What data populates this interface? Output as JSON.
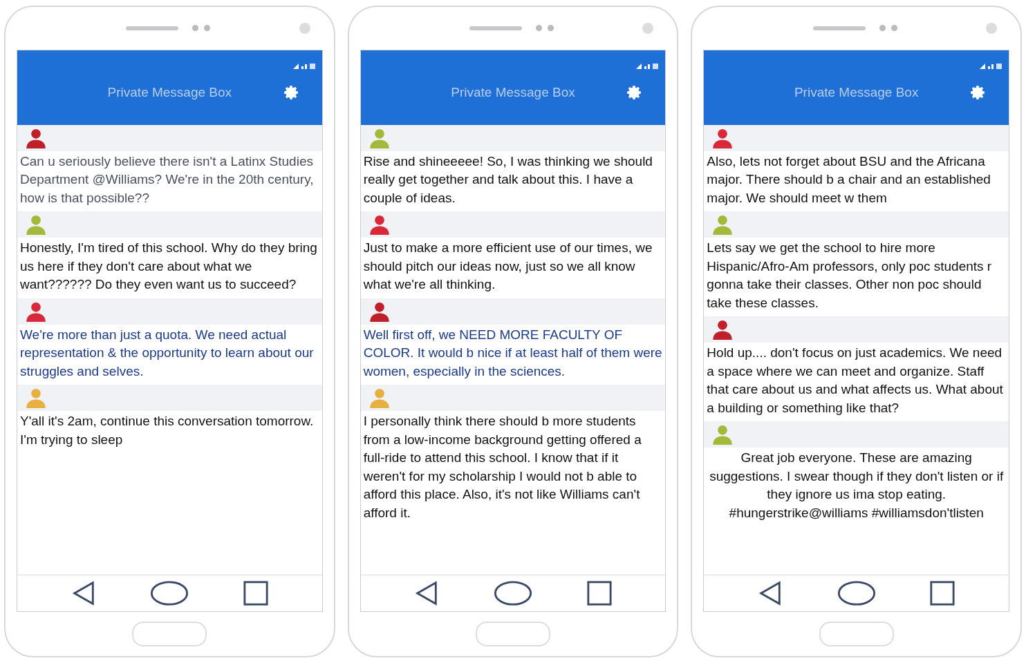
{
  "phones": [
    {
      "title": "Private Message Box",
      "messages": [
        {
          "color": "#c0202a",
          "kind": "muted",
          "text": "Can u seriously believe there isn't a Latinx Studies Department @Williams? We're in the 20th century, how is that possible??"
        },
        {
          "color": "#a4b83a",
          "kind": "plain",
          "text": "Honestly, I'm tired of this school. Why do they bring us here if they don't care about what we want?????? Do they even want us to succeed?"
        },
        {
          "color": "#d8283a",
          "kind": "accent",
          "text": "We're more than just a quota. We need actual representation & the opportunity to learn about our struggles and selves."
        },
        {
          "color": "#e8b040",
          "kind": "plain",
          "text": "Y'all it's 2am, continue this conversation tomorrow. I'm trying to sleep"
        }
      ]
    },
    {
      "title": "Private Message Box",
      "messages": [
        {
          "color": "#a4b83a",
          "kind": "plain",
          "text": "Rise and shineeeee! So, I was thinking we should really get together and talk about this. I have a couple of ideas."
        },
        {
          "color": "#d8283a",
          "kind": "plain",
          "text": "Just to make a more efficient use of our times, we should pitch our ideas now, just so we all know what we're all thinking."
        },
        {
          "color": "#c0202a",
          "kind": "accent",
          "text": "Well first off, we NEED MORE FACULTY OF COLOR. It would b nice if at least half of them were women, especially in the sciences."
        },
        {
          "color": "#e8b040",
          "kind": "plain",
          "text": "I personally think there should b more students from a low-income background getting offered a full-ride to attend this school. I know that if it weren't for my scholarship I would not b able to afford this place. Also, it's not like Williams can't afford it."
        }
      ]
    },
    {
      "title": "Private Message Box",
      "messages": [
        {
          "color": "#d8283a",
          "kind": "plain",
          "text": "Also, lets not forget about BSU and the Africana major. There should b a chair and an established major. We should meet w them"
        },
        {
          "color": "#a4b83a",
          "kind": "plain",
          "text": "Lets say we get the school to hire more Hispanic/Afro-Am professors, only poc students r gonna take their classes. Other non poc should take these classes."
        },
        {
          "color": "#c0202a",
          "kind": "plain",
          "text": "Hold up.... don't focus on just academics. We need a space where we can meet and organize. Staff that care about us and what affects us. What about a building or something like that?"
        },
        {
          "color": "#a4b83a",
          "kind": "centered",
          "text": "Great job everyone. These are amazing suggestions. I swear though if they don't listen or if they ignore us ima stop eating. #hungerstrike@williams #williamsdon'tlisten"
        }
      ]
    }
  ]
}
